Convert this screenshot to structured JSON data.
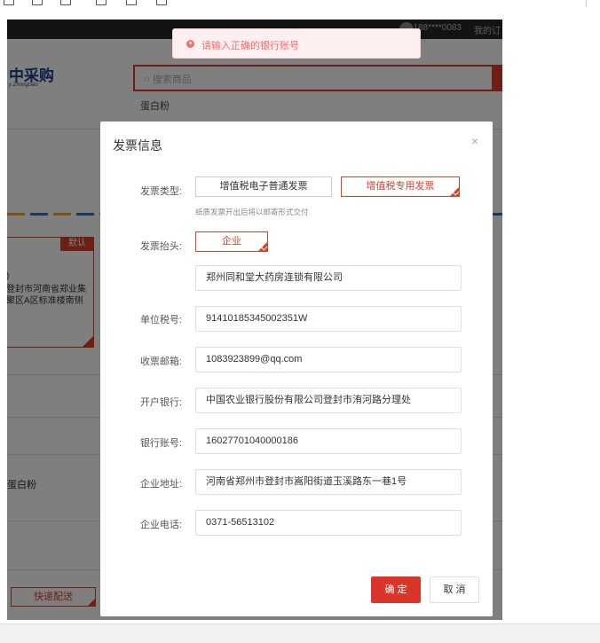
{
  "frame": {
    "user_phone": "188****0083",
    "my_link": "我的订",
    "logo_text": "中采购",
    "logo_sub": "y Zhongcaio",
    "search_placeholder": "搜索商品",
    "search_hint": "蛋白粉",
    "address_default_tag": "默认",
    "address_line1": ")",
    "address_text": "登封市河南省郑业集聚区A区标准楼南侧",
    "product_name": "蛋白粉",
    "express_label": "快递配送"
  },
  "toast": {
    "message": "请输入正确的银行账号",
    "icon": "error-icon"
  },
  "modal": {
    "title": "发票信息",
    "close_icon": "close-icon",
    "invoice_type_label": "发票类型:",
    "invoice_types": [
      {
        "label": "增值税电子普通发票",
        "selected": false
      },
      {
        "label": "增值税专用发票",
        "selected": true
      }
    ],
    "invoice_note": "纸质发票开出后将以邮寄形式交付",
    "header_label": "发票抬头:",
    "header_option": "企业",
    "company_name": "郑州同和堂大药房连锁有限公司",
    "fields": [
      {
        "label": "单位税号:",
        "value": "91410185345002351W"
      },
      {
        "label": "收票邮箱:",
        "value": "1083923899@qq.com"
      },
      {
        "label": "开户银行:",
        "value": "中国农业银行股份有限公司登封市洧河路分理处"
      },
      {
        "label": "银行账号:",
        "value": "16027701040000186"
      },
      {
        "label": "企业地址:",
        "value": "河南省郑州市登封市嵩阳街道玉溪路东一巷1号"
      },
      {
        "label": "企业电话:",
        "value": "0371-56513102"
      }
    ],
    "confirm_label": "确 定",
    "cancel_label": "取 消"
  },
  "colors": {
    "accent": "#d9412b",
    "toast_bg": "#fef0f0",
    "toast_text": "#f56c6c"
  }
}
